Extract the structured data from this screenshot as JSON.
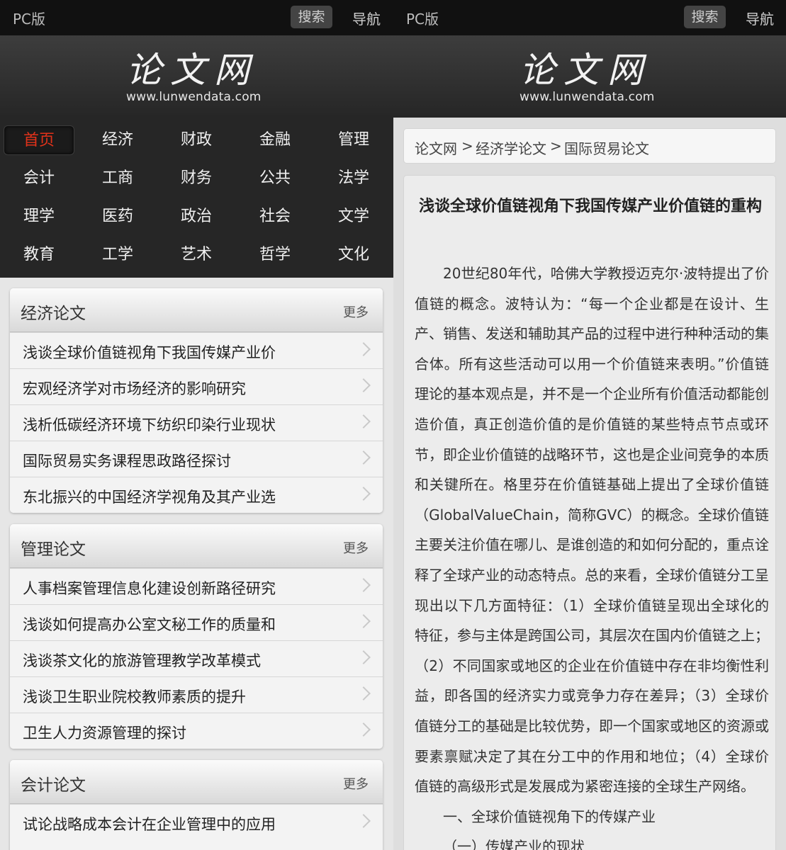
{
  "topbar": {
    "pc_label": "PC版",
    "search_label": "搜索",
    "nav_label": "导航"
  },
  "logo": {
    "mark": "论文网",
    "domain": "www.lunwendata.com"
  },
  "categories": [
    "首页",
    "经济",
    "财政",
    "金融",
    "管理",
    "会计",
    "工商",
    "财务",
    "公共",
    "法学",
    "理学",
    "医药",
    "政治",
    "社会",
    "文学",
    "教育",
    "工学",
    "艺术",
    "哲学",
    "文化"
  ],
  "sections": [
    {
      "title": "经济论文",
      "more": "更多",
      "items": [
        "浅谈全球价值链视角下我国传媒产业价",
        "宏观经济学对市场经济的影响研究",
        "浅析低碳经济环境下纺织印染行业现状",
        "国际贸易实务课程思政路径探讨",
        "东北振兴的中国经济学视角及其产业选"
      ]
    },
    {
      "title": "管理论文",
      "more": "更多",
      "items": [
        "人事档案管理信息化建设创新路径研究",
        "浅谈如何提高办公室文秘工作的质量和",
        "浅谈茶文化的旅游管理教学改革模式",
        "浅谈卫生职业院校教师素质的提升",
        "卫生人力资源管理的探讨"
      ]
    },
    {
      "title": "会计论文",
      "more": "更多",
      "items": [
        "试论战略成本会计在企业管理中的应用"
      ]
    }
  ],
  "breadcrumb": {
    "home": "论文网",
    "sep1": ">",
    "level1": "经济学论文",
    "sep2": ">",
    "level2": "国际贸易论文"
  },
  "article": {
    "title": "浅谈全球价值链视角下我国传媒产业价值链的重构",
    "paragraph": "20世纪80年代，哈佛大学教授迈克尔·波特提出了价值链的概念。波特认为：“每一个企业都是在设计、生产、销售、发送和辅助其产品的过程中进行种种活动的集合体。所有这些活动可以用一个价值链来表明。”价值链理论的基本观点是，并不是一个企业所有价值活动都能创造价值，真正创造价值的是价值链的某些特点节点或环节，即企业价值链的战略环节，这也是企业间竞争的本质和关键所在。格里芬在价值链基础上提出了全球价值链（GlobalValueChain，简称GVC）的概念。全球价值链主要关注价值在哪儿、是谁创造的和如何分配的，重点诠释了全球产业的动态特点。总的来看，全球价值链分工呈现出以下几方面特征：（1）全球价值链呈现出全球化的特征，参与主体是跨国公司，其层次在国内价值链之上；（2）不同国家或地区的企业在价值链中存在非均衡性利益，即各国的经济实力或竞争力存在差异；（3）全球价值链分工的基础是比较优势，即一个国家或地区的资源或要素禀赋决定了其在分工中的作用和地位；（4）全球价值链的高级形式是发展成为紧密连接的全球生产网络。",
    "heading1": "一、全球价值链视角下的传媒产业",
    "heading2": "（一）传媒产业的现状"
  }
}
